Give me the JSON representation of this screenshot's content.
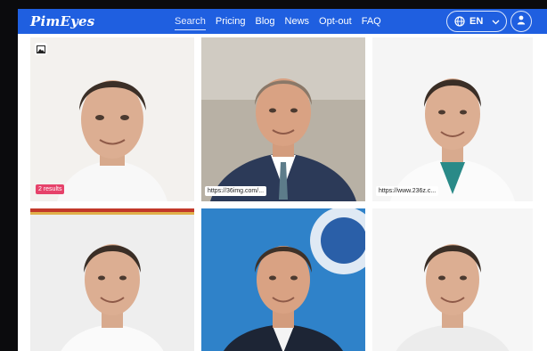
{
  "brand": {
    "logo_text": "PimEyes"
  },
  "nav": {
    "links": [
      "Search",
      "Pricing",
      "Blog",
      "News",
      "Opt-out",
      "FAQ"
    ],
    "active": "Search"
  },
  "language": {
    "code": "EN"
  },
  "results": [
    {
      "label": "2 results",
      "label_type": "count"
    },
    {
      "label": "https://36img.com/...",
      "label_type": "url"
    },
    {
      "label": "https://www.236z.c...",
      "label_type": "url"
    },
    {
      "label": "",
      "label_type": "none"
    },
    {
      "label": "",
      "label_type": "none"
    },
    {
      "label": "",
      "label_type": "none"
    }
  ],
  "colors": {
    "nav_bg": "#1f5fe0",
    "badge": "#e6426a"
  }
}
